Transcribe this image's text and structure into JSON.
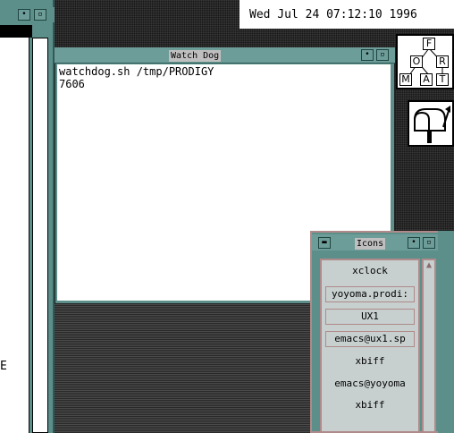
{
  "clock": {
    "text": "Wed Jul 24 07:12:10 1996"
  },
  "left_window": {
    "fragment": "E"
  },
  "watchdog": {
    "title": "Watch Dog",
    "lines": [
      "watchdog.sh /tmp/PRODIGY",
      "7606"
    ]
  },
  "format_icon": {
    "letters": [
      "F",
      "O",
      "R",
      "M",
      "A",
      "T"
    ]
  },
  "icon_manager": {
    "title": "Icons",
    "items": [
      {
        "label": "xclock"
      },
      {
        "label": "yoyoma.prodi:"
      },
      {
        "label": "UX1"
      },
      {
        "label": "emacs@ux1.sp"
      },
      {
        "label": "xbiff"
      },
      {
        "label": "emacs@yoyoma"
      },
      {
        "label": "xbiff"
      }
    ]
  },
  "colors": {
    "frame": "#5d8f8a",
    "accent": "#b08a8a",
    "panel": "#c7cfcf"
  }
}
